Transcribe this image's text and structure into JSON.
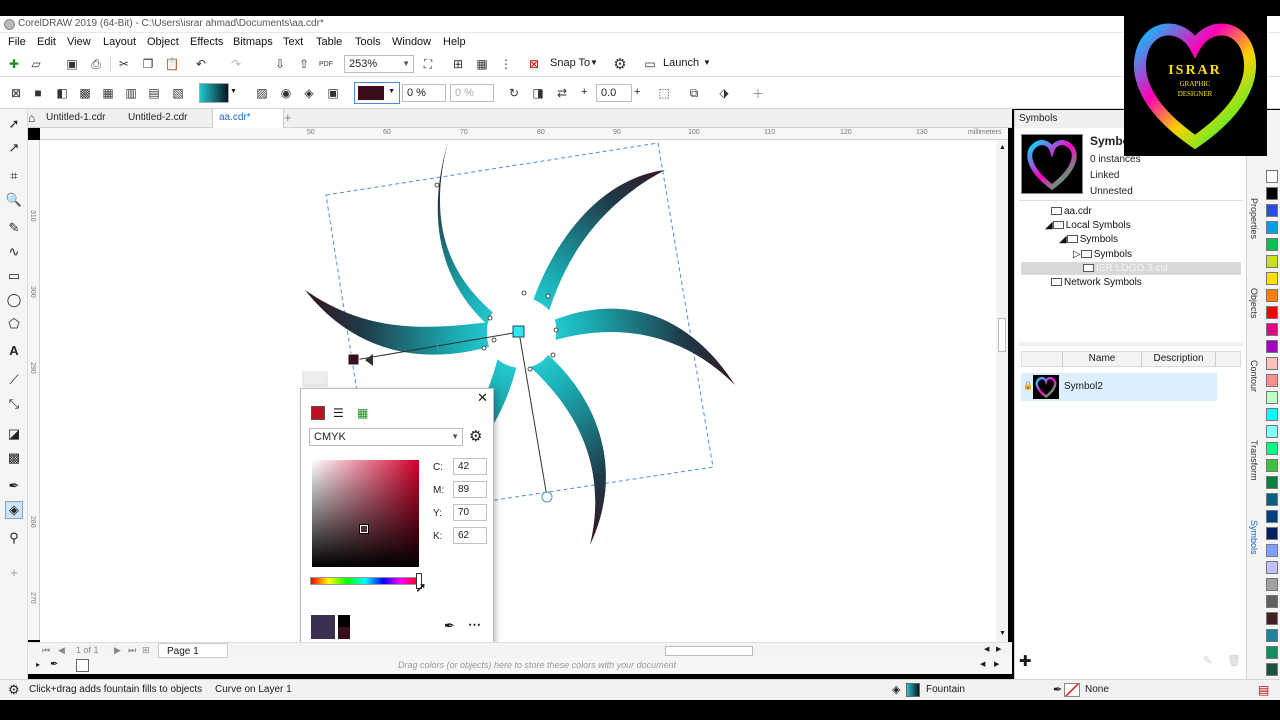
{
  "window": {
    "title": "CorelDRAW 2019 (64-Bit) - C:\\Users\\israr ahmad\\Documents\\aa.cdr*"
  },
  "menu": [
    "File",
    "Edit",
    "View",
    "Layout",
    "Object",
    "Effects",
    "Bitmaps",
    "Text",
    "Table",
    "Tools",
    "Window",
    "Help"
  ],
  "toolbar": {
    "zoom": "253%",
    "snap_to": "Snap To",
    "launch": "Launch",
    "pdf": "PDF"
  },
  "property_bar": {
    "transparency_1": "0 %",
    "transparency_2": "0 %",
    "angle": "0.0",
    "angle_prefix": "+"
  },
  "doc_tabs": [
    "Untitled-1.cdr",
    "Untitled-2.cdr",
    "aa.cdr*"
  ],
  "ruler": {
    "h_labels": [
      "50",
      "60",
      "70",
      "80",
      "90",
      "100",
      "110",
      "120",
      "130"
    ],
    "v_labels": [
      "310",
      "300",
      "290",
      "280",
      "270"
    ],
    "unit": "millimeters"
  },
  "color_popup": {
    "model": "CMYK",
    "fields": [
      {
        "label": "C:",
        "value": "42"
      },
      {
        "label": "M:",
        "value": "89"
      },
      {
        "label": "Y:",
        "value": "70"
      },
      {
        "label": "K:",
        "value": "62"
      }
    ],
    "selected_color": "#4a0d1a"
  },
  "page_nav": {
    "count": "1 of 1",
    "page_tab": "Page 1"
  },
  "palette_hint": "Drag colors (or objects) here to store these colors with your document",
  "status": {
    "hint": "Click+drag adds fountain fills to objects",
    "object": "Curve on Layer 1",
    "fill": "Fountain",
    "outline": "None"
  },
  "docker": {
    "title": "Symbols",
    "symbol_name": "Symbol",
    "instances": "0 instances",
    "linked": "Linked",
    "nesting": "Unnested",
    "tree": [
      "aa.cdr",
      "Local Symbols",
      "Symbols",
      "Symbols",
      "ISR LOGO 3.csl",
      "Network Symbols"
    ],
    "columns": [
      "Name",
      "Description"
    ],
    "rows": [
      {
        "name": "Symbol2"
      }
    ]
  },
  "docker_tabs": [
    "Properties",
    "Objects",
    "Contour",
    "Transform",
    "Symbols"
  ],
  "logo": {
    "line1": "ISRAR",
    "line2": "GRAPHIC",
    "line3": "DESIGNER"
  },
  "colors": {
    "accent": "#1e64c8",
    "fill_dark": "#3a0e1c",
    "fill_cyan": "#19c8d2",
    "palette": [
      "#ffffff",
      "#000000",
      "#2a4de0",
      "#00a0e8",
      "#00c050",
      "#c8e020",
      "#ffe000",
      "#ff8000",
      "#ff0000",
      "#e00080",
      "#a000c0",
      "#ffc0c0",
      "#ff9090",
      "#c0ffc0",
      "#00ffff",
      "#80ffff",
      "#00ff80",
      "#40c040",
      "#008040",
      "#006080",
      "#004080",
      "#002060",
      "#80a0ff",
      "#c0c0ff",
      "#a0a0a0",
      "#606060",
      "#402020",
      "#2080a0",
      "#109060",
      "#205040",
      "#0060c0",
      "#003080"
    ]
  }
}
